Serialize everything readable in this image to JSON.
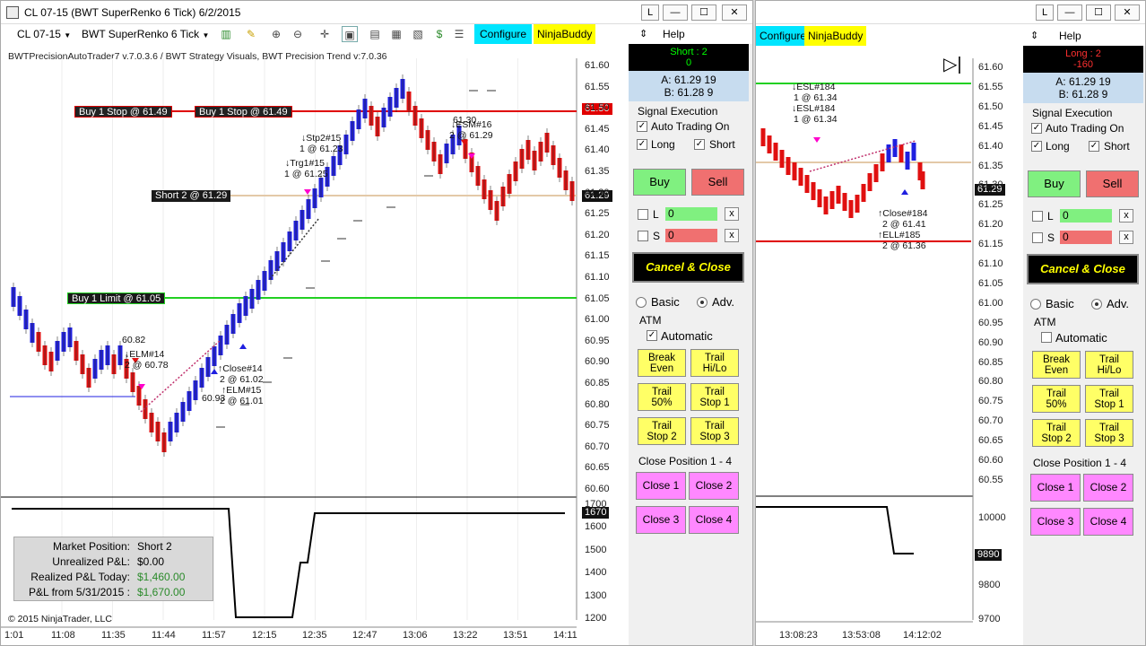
{
  "window1": {
    "title": "CL 07-15 (BWT SuperRenko  6 Tick)  6/2/2015",
    "title_buttons": [
      "L",
      "—",
      "☐",
      "✕"
    ],
    "toolbar": {
      "instrument": "CL 07-15",
      "bar_type": "BWT SuperRenko  6 Tick",
      "configure": "Configure",
      "ninjabuddy": "NinjaBuddy",
      "help": "Help"
    },
    "indicator_line": "BWTPrecisionAutoTrader7 v.7.0.3.6 / BWT Strategy Visuals, BWT Precision Trend v:7.0.36",
    "orders": {
      "buy_stop_left": "Buy 1 Stop @ 61.49",
      "buy_stop_right": "Buy 1 Stop @ 61.49",
      "short": "Short 2 @ 61.29",
      "buy_limit": "Buy 1 Limit @ 61.05"
    },
    "price_tags": {
      "stop": "61.50",
      "last": "61.29",
      "pnl": "1670"
    },
    "price_axis": [
      "61.60",
      "61.55",
      "61.50",
      "61.45",
      "61.40",
      "61.35",
      "61.30",
      "61.25",
      "61.20",
      "61.15",
      "61.10",
      "61.05",
      "61.00",
      "60.95",
      "60.90",
      "60.85",
      "60.80",
      "60.75",
      "60.70",
      "60.65",
      "60.60"
    ],
    "pnl_axis": [
      "1700",
      "1600",
      "1500",
      "1400",
      "1300",
      "1200"
    ],
    "time_axis": [
      "1:01",
      "11:08",
      "11:35",
      "11:44",
      "11:57",
      "12:15",
      "12:35",
      "12:47",
      "13:06",
      "13:22",
      "13:51",
      "14:11"
    ],
    "annotations": {
      "a1": "60.82",
      "a2": "↓ELM#14",
      "a3": "2 @ 60.78",
      "a4": "↑Close#14",
      "a5": "2 @ 61.02",
      "a6": "↑ELM#15",
      "a7": "2 @ 61.01",
      "a8": "60.93",
      "a9": "↓Stp2#15",
      "a10": "1 @ 61.23",
      "a11": "↓Trg1#15",
      "a12": "1 @ 61.25",
      "a13": "61.30",
      "a14": "↓ESM#16",
      "a15": "2 @ 61.29"
    },
    "pnl_box": {
      "rows": [
        {
          "k": "Market Position:",
          "v": "Short 2"
        },
        {
          "k": "Unrealized P&L:",
          "v": "$0.00"
        },
        {
          "k": "Realized P&L Today:",
          "v": "$1,460.00"
        },
        {
          "k": "P&L from 5/31/2015 :",
          "v": "$1,670.00"
        }
      ],
      "green": "#2a8a2a"
    },
    "copyright": "© 2015 NinjaTrader, LLC"
  },
  "panel1": {
    "position": {
      "line1": "Short : 2",
      "line2": "0"
    },
    "ask": "A: 61.29 19",
    "bid": "B: 61.28 9",
    "signal_execution": "Signal Execution",
    "auto_trading": "Auto Trading On",
    "long": "Long",
    "short": "Short",
    "buy": "Buy",
    "sell": "Sell",
    "l_label": "L",
    "s_label": "S",
    "l_value": "0",
    "s_value": "0",
    "x": "x",
    "cancel_close": "Cancel & Close",
    "basic": "Basic",
    "adv": "Adv.",
    "atm": "ATM",
    "automatic": "Automatic",
    "btns": [
      {
        "l1": "Break",
        "l2": "Even"
      },
      {
        "l1": "Trail",
        "l2": "Hi/Lo"
      },
      {
        "l1": "Trail",
        "l2": "50%"
      },
      {
        "l1": "Trail",
        "l2": "Stop 1"
      },
      {
        "l1": "Trail",
        "l2": "Stop 2"
      },
      {
        "l1": "Trail",
        "l2": "Stop 3"
      }
    ],
    "close_position": "Close Position 1 - 4",
    "close": [
      "Close 1",
      "Close 2",
      "Close 3",
      "Close 4"
    ]
  },
  "window2": {
    "title_buttons": [
      "L",
      "—",
      "☐",
      "✕"
    ],
    "configure": "Configure",
    "ninjabuddy": "NinjaBuddy",
    "help": "Help",
    "price_axis": [
      "61.60",
      "61.55",
      "61.50",
      "61.45",
      "61.40",
      "61.35",
      "61.30",
      "61.25",
      "61.20",
      "61.15",
      "61.10",
      "61.05",
      "61.00",
      "60.95",
      "60.90",
      "60.85",
      "60.80",
      "60.75",
      "60.70",
      "60.65",
      "60.60",
      "60.55"
    ],
    "pnl_axis": [
      "10000",
      "9800",
      "9700"
    ],
    "price_tags": {
      "last": "61.29",
      "pnl": "9890"
    },
    "time_axis": [
      "13:08:23",
      "13:53:08",
      "14:12:02"
    ],
    "annotations": {
      "b1": "↓ESL#184",
      "b2": "1 @ 61.34",
      "b3": "↓ESL#184",
      "b4": "1 @ 61.34",
      "b5": "↑Close#184",
      "b6": "2 @ 61.41",
      "b7": "↑ELL#185",
      "b8": "2 @ 61.36"
    }
  },
  "panel2": {
    "position": {
      "line1": "Long : 2",
      "line2": "-160"
    },
    "ask": "A: 61.29 19",
    "bid": "B: 61.28 9",
    "signal_execution": "Signal Execution",
    "auto_trading": "Auto Trading On",
    "long": "Long",
    "short": "Short",
    "buy": "Buy",
    "sell": "Sell",
    "l_label": "L",
    "s_label": "S",
    "l_value": "0",
    "s_value": "0",
    "x": "x",
    "cancel_close": "Cancel & Close",
    "basic": "Basic",
    "adv": "Adv.",
    "atm": "ATM",
    "automatic": "Automatic",
    "btns": [
      {
        "l1": "Break",
        "l2": "Even"
      },
      {
        "l1": "Trail",
        "l2": "Hi/Lo"
      },
      {
        "l1": "Trail",
        "l2": "50%"
      },
      {
        "l1": "Trail",
        "l2": "Stop 1"
      },
      {
        "l1": "Trail",
        "l2": "Stop 2"
      },
      {
        "l1": "Trail",
        "l2": "Stop 3"
      }
    ],
    "close_position": "Close Position 1 - 4",
    "close": [
      "Close 1",
      "Close 2",
      "Close 3",
      "Close 4"
    ]
  },
  "colors": {
    "up": "#1f1fe0",
    "down": "#e01010",
    "buy_stop_line": "#e00000",
    "short_line": "#e3c9a8",
    "limit_line": "#22d022",
    "short_pos": "#00ff00",
    "long_pos": "#ff3030"
  }
}
